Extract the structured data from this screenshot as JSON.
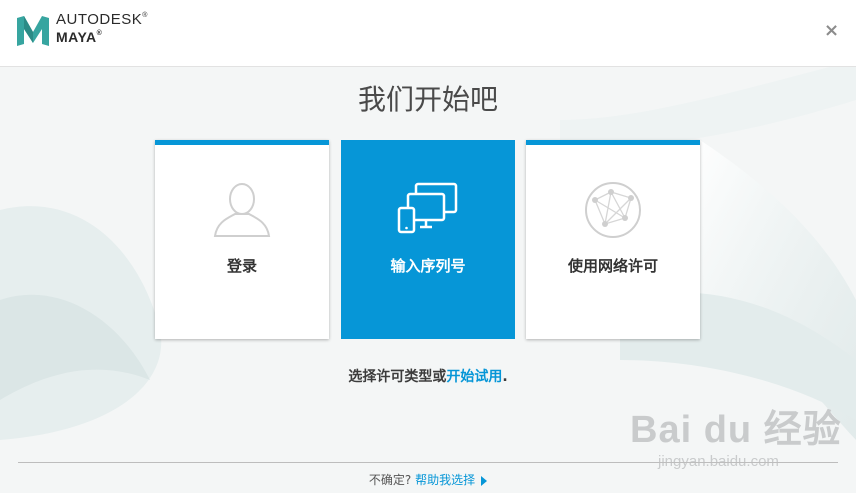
{
  "header": {
    "company": "AUTODESK",
    "product": "MAYA",
    "registered_mark": "®",
    "close_glyph": "×"
  },
  "title": "我们开始吧",
  "cards": [
    {
      "label": "登录",
      "icon": "user-silhouette-icon",
      "selected": false
    },
    {
      "label": "输入序列号",
      "icon": "devices-icon",
      "selected": true
    },
    {
      "label": "使用网络许可",
      "icon": "network-globe-icon",
      "selected": false
    }
  ],
  "prompt": {
    "text": "选择许可类型或",
    "link": "开始试用",
    "end": "."
  },
  "footer": {
    "question": "不确定?",
    "help_link": "帮助我选择"
  },
  "watermark": {
    "brand": "Bai du 经验",
    "url": "jingyan.baidu.com"
  },
  "colors": {
    "accent": "#0696d7",
    "logo": "#37a5a0",
    "text": "#333333"
  }
}
